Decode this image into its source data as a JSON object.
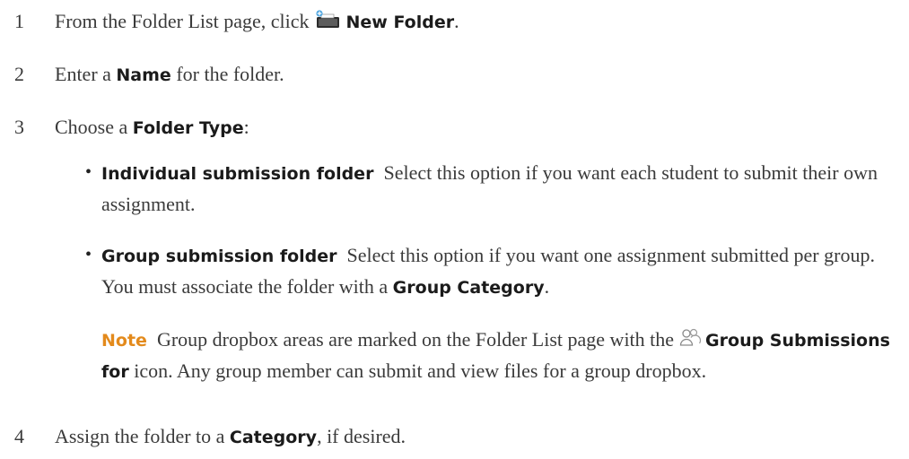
{
  "steps": [
    {
      "num": "1",
      "pre": "From the Folder List page, click",
      "icon": "new-folder-icon",
      "ui": "New Folder",
      "post": "."
    },
    {
      "num": "2",
      "pre": "Enter a",
      "ui": "Name",
      "post": "for the folder."
    },
    {
      "num": "3",
      "pre": "Choose a",
      "ui": "Folder Type",
      "post": ":"
    },
    {
      "num": "4",
      "pre": "Assign the folder to a",
      "ui": "Category",
      "post": ", if desired."
    }
  ],
  "folder_types": [
    {
      "ui": "Individual submission folder",
      "desc": "Select this option if you want each student to submit their own assignment."
    },
    {
      "ui": "Group submission folder",
      "desc": "Select this option if you want one assignment submitted per group. You must associate the folder with a",
      "ui2": "Group Category",
      "post": "."
    }
  ],
  "note": {
    "label": "Note",
    "pre": "Group dropbox areas are marked on the Folder List page with the",
    "icon": "group-submissions-icon",
    "ui": "Group Submissions for",
    "post": "icon. Any group member can submit and view files for a group dropbox."
  },
  "colors": {
    "text": "#3a3a3a",
    "ui_text": "#1b1b1b",
    "note_label": "#e38a1c",
    "icon_blue": "#4aa3df"
  }
}
